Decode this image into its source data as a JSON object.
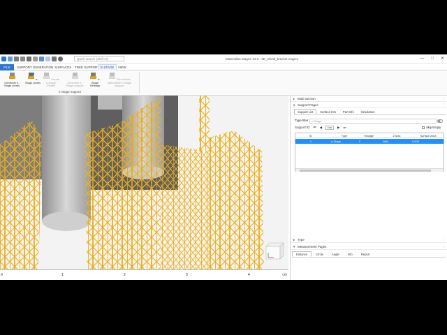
{
  "titlebar": {
    "search_placeholder": "Quick search (Shift+S)",
    "window_title": "Materialise Magics 23.0 - 3D_wheel_bracket.magics",
    "controls": [
      "—",
      "□",
      "✕"
    ]
  },
  "ribbon_tabs": [
    {
      "label": "FILE"
    },
    {
      "label": "SUPPORT GENERATION"
    },
    {
      "label": "SURFACES"
    },
    {
      "label": "TREE SUPPORT"
    },
    {
      "label": "E-STAGE"
    },
    {
      "label": "VIEW"
    }
  ],
  "ribbon": {
    "buttons": [
      {
        "label": "Generate e-Stage points",
        "icon": "generate-points-icon",
        "enabled": true
      },
      {
        "label": "e-Stage points",
        "icon": "estage-points-icon",
        "enabled": true
      },
      {
        "label": "Create e-Stage Profile",
        "icon": "create-profile-icon",
        "enabled": false
      },
      {
        "label": "Generate e-Stage support",
        "icon": "generate-support-icon",
        "enabled": false
      },
      {
        "label": "e-Stage Settings",
        "icon": "estage-settings-icon",
        "enabled": true
      },
      {
        "label": "Show/Hide Materialise e-Stage support",
        "icon": "show-hide-icon",
        "enabled": false
      }
    ],
    "group_label": "e-Stage support"
  },
  "ruler": {
    "ticks": [
      "0",
      "1",
      "2",
      "3",
      "4"
    ],
    "unit": "cm"
  },
  "panel": {
    "multi_section": "Multi Section",
    "support_pages": "Support Pages",
    "subtabs": [
      "Support List",
      "Surface Info",
      "Part Info",
      "Simulation"
    ],
    "type_filter_label": "Type filter",
    "type_filter_value": "e-Stage",
    "support_id_label": "Support ID",
    "support_id_value": "n/a",
    "skip_empty_label": "Skip Empty",
    "table": {
      "columns": [
        "ID",
        "Type",
        "Triangle",
        "Z Max",
        "Surface Area"
      ],
      "rows": [
        [
          "1",
          "e-Stage",
          "0",
          "NaN",
          "0.000"
        ]
      ]
    },
    "type_section": "Type",
    "measurement_pages": "Measurement Pages",
    "measure_tabs": [
      "Distance",
      "Circle",
      "Angle",
      "Info",
      "Report"
    ]
  },
  "colors": {
    "support_yellow": "#f2b51f",
    "part_gray": "#9a9a9a",
    "selection_blue": "#1e90ff",
    "file_tab_blue": "#2e74d0"
  }
}
